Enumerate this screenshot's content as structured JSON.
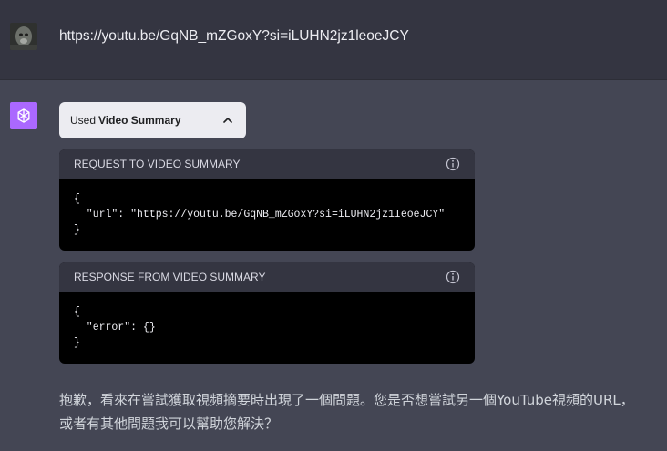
{
  "user_message": {
    "text": "https://youtu.be/GqNB_mZGoxY?si=iLUHN2jz1leoeJCY"
  },
  "plugin": {
    "used_label": "Used",
    "name": "Video Summary"
  },
  "request": {
    "header": "REQUEST TO VIDEO SUMMARY",
    "code": "{\n  \"url\": \"https://youtu.be/GqNB_mZGoxY?si=iLUHN2jz1IeoeJCY\"\n}"
  },
  "response": {
    "header": "RESPONSE FROM VIDEO SUMMARY",
    "code": "{\n  \"error\": {}\n}"
  },
  "assistant_reply": {
    "text": "抱歉，看來在嘗試獲取視頻摘要時出現了一個問題。您是否想嘗試另一個YouTube視頻的URL，或者有其他問題我可以幫助您解決？"
  },
  "colors": {
    "assistant_avatar": "#ab68ff",
    "user_bg": "#343541",
    "assistant_bg": "#444654"
  }
}
